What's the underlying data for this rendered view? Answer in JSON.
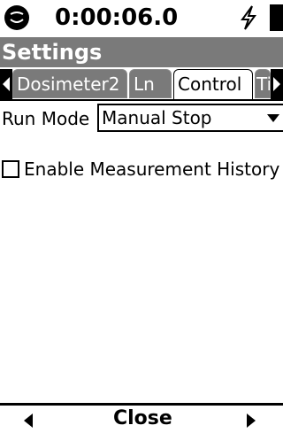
{
  "status": {
    "time": "0:00:06.0",
    "logo_icon": "smiley-logo-icon",
    "power_icon": "power-bolt-icon",
    "battery_icon": "battery-icon"
  },
  "title": "Settings",
  "tabs": [
    {
      "label": "Dosimeter2",
      "active": false
    },
    {
      "label": "Ln",
      "active": false
    },
    {
      "label": "Control",
      "active": true
    },
    {
      "label": "Ti",
      "active": false
    }
  ],
  "control": {
    "run_mode_label": "Run Mode",
    "run_mode_value": "Manual Stop",
    "enable_history_label": "Enable Measurement History",
    "enable_history_checked": false
  },
  "bottom": {
    "close_label": "Close",
    "left_icon": "arrow-left-icon",
    "right_icon": "arrow-right-icon"
  }
}
